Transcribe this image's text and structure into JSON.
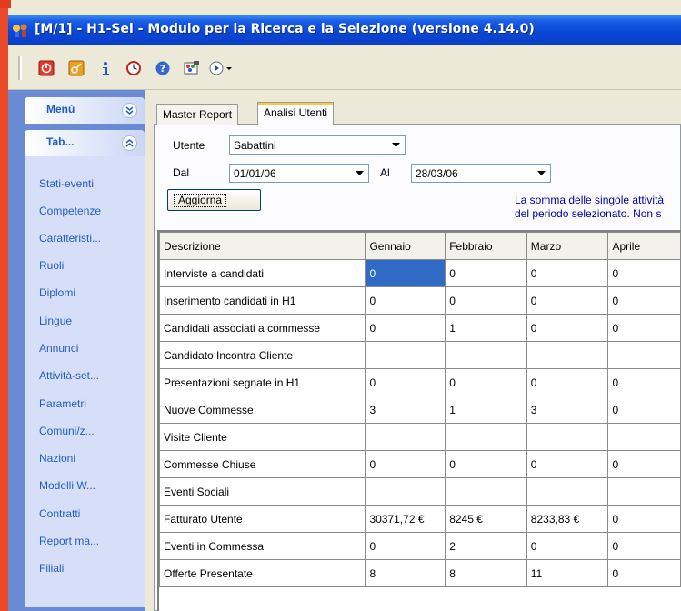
{
  "window": {
    "title": "[M/1] - H1-Sel - Modulo per la Ricerca e la Selezione (versione 4.14.0)"
  },
  "toolbar": {
    "icons": [
      "power-icon",
      "key-icon",
      "info-icon",
      "clock-icon",
      "help-icon",
      "paint-icon",
      "play-dropdown-icon"
    ]
  },
  "sidebar": {
    "menu_label": "Menù",
    "tab_label": "Tab...",
    "items": [
      "Stati-eventi",
      "Competenze",
      "Caratteristi...",
      "Ruoli",
      "Diplomi",
      "Lingue",
      "Annunci",
      "Attività-set...",
      "Parametri",
      "Comuni/z...",
      "Nazioni",
      "Modelli W...",
      "Contratti",
      "Report ma...",
      "Filiali"
    ]
  },
  "tabs": {
    "master_report": "Master Report",
    "analisi_utenti": "Analisi Utenti"
  },
  "filters": {
    "utente_label": "Utente",
    "utente_value": "Sabattini",
    "dal_label": "Dal",
    "dal_value": "01/01/06",
    "al_label": "Al",
    "al_value": "28/03/06",
    "aggiorna_label": "Aggiorna",
    "note_line1": "La somma delle singole attività",
    "note_line2": "del periodo selezionato. Non s"
  },
  "table": {
    "headers": [
      "Descrizione",
      "Gennaio",
      "Febbraio",
      "Marzo",
      "Aprile"
    ],
    "rows": [
      [
        "Interviste a candidati",
        "0",
        "0",
        "0",
        "0"
      ],
      [
        "Inserimento candidati in H1",
        "0",
        "0",
        "0",
        "0"
      ],
      [
        "Candidati associati a commesse",
        "0",
        "1",
        "0",
        "0"
      ],
      [
        "Candidato Incontra Cliente",
        "",
        "",
        "",
        ""
      ],
      [
        "Presentazioni segnate in H1",
        "0",
        "0",
        "0",
        "0"
      ],
      [
        "Nuove Commesse",
        "3",
        "1",
        "3",
        "0"
      ],
      [
        "Visite Cliente",
        "",
        "",
        "",
        ""
      ],
      [
        "Commesse Chiuse",
        "0",
        "0",
        "0",
        "0"
      ],
      [
        "Eventi Sociali",
        "",
        "",
        "",
        ""
      ],
      [
        "Fatturato Utente",
        "30371,72 €",
        "8245 €",
        "8233,83 €",
        "0"
      ],
      [
        "Eventi in Commessa",
        "0",
        "2",
        "0",
        "0"
      ],
      [
        "Offerte Presentate",
        "8",
        "8",
        "11",
        "0"
      ]
    ]
  }
}
